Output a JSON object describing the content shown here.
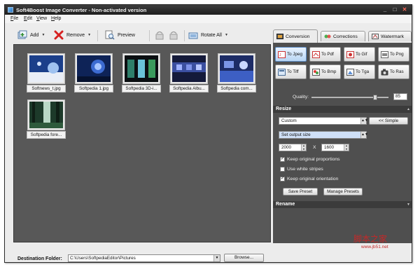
{
  "window": {
    "title": "Soft4Boost Image Converter - Non-activated version",
    "controls": [
      "_",
      "□",
      "✕"
    ]
  },
  "menu": [
    "File",
    "Edit",
    "View",
    "Help"
  ],
  "toolbar": {
    "add_label": "Add",
    "remove_label": "Remove",
    "preview_label": "Preview",
    "rotate_all_label": "Rotate All"
  },
  "gallery": {
    "items": [
      {
        "name": "Softnews_t.jpg"
      },
      {
        "name": "Softpedia 1.jpg"
      },
      {
        "name": "Softpedia 3D-i..."
      },
      {
        "name": "Softpedia Albu..."
      },
      {
        "name": "Softpedia com..."
      },
      {
        "name": "Softpedia fore..."
      }
    ]
  },
  "destination": {
    "label": "Destination Folder:",
    "path": "C:\\Users\\SoftpediaEditor\\Pictures",
    "browse_label": "Browse..."
  },
  "tabs": [
    {
      "label": "Conversion",
      "icon": "conversion-icon"
    },
    {
      "label": "Corrections",
      "icon": "corrections-icon"
    },
    {
      "label": "Watermark",
      "icon": "watermark-icon"
    }
  ],
  "formats": [
    {
      "label": "To Jpeg",
      "icon": "jpeg-icon"
    },
    {
      "label": "To Pdf",
      "icon": "pdf-icon"
    },
    {
      "label": "To Gif",
      "icon": "gif-icon"
    },
    {
      "label": "To Png",
      "icon": "png-icon"
    },
    {
      "label": "To Tiff",
      "icon": "tiff-icon"
    },
    {
      "label": "To Bmp",
      "icon": "bmp-icon"
    },
    {
      "label": "To Tga",
      "icon": "tga-icon"
    },
    {
      "label": "To Ras",
      "icon": "ras-icon"
    }
  ],
  "quality": {
    "label": "Quality:",
    "value": "85"
  },
  "resize": {
    "header": "Resize",
    "preset": "Custom",
    "simple_label": "<< Simple",
    "mode": "Set output size",
    "width": "2000",
    "x_label": "X",
    "height": "1600",
    "keep_proportions": "Keep original proportions",
    "white_stripes": "Use white stripes",
    "keep_orientation": "Keep original orientation",
    "save_preset": "Save Preset",
    "manage_presets": "Manage Presets"
  },
  "rename": {
    "header": "Rename"
  },
  "watermark_overlay": {
    "text": "脚本之家",
    "sub": "www.jb51.net"
  }
}
